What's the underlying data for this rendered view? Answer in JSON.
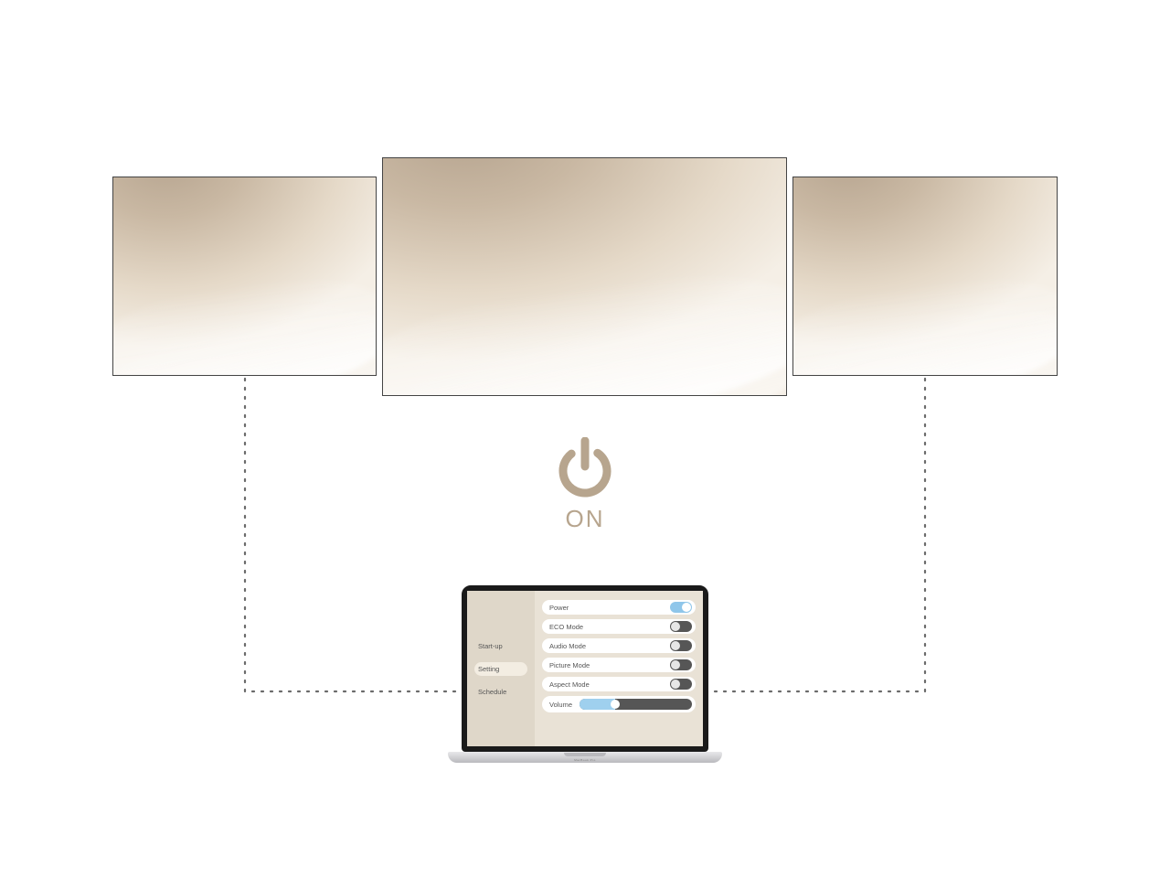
{
  "power": {
    "label": "ON"
  },
  "laptop": {
    "brand": "MacBook Pro",
    "sidebar": {
      "items": [
        {
          "label": "Start-up",
          "active": false
        },
        {
          "label": "Setting",
          "active": true
        },
        {
          "label": "Schedule",
          "active": false
        }
      ]
    },
    "settings": {
      "rows": [
        {
          "label": "Power",
          "type": "toggle",
          "on": true
        },
        {
          "label": "ECO Mode",
          "type": "toggle",
          "on": false
        },
        {
          "label": "Audio Mode",
          "type": "toggle",
          "on": false
        },
        {
          "label": "Picture Mode",
          "type": "toggle",
          "on": false
        },
        {
          "label": "Aspect Mode",
          "type": "toggle",
          "on": false
        },
        {
          "label": "Volume",
          "type": "slider",
          "value": 32
        }
      ]
    }
  },
  "colors": {
    "accent_tan": "#b7a58e",
    "toggle_on": "#8fc6ea"
  }
}
